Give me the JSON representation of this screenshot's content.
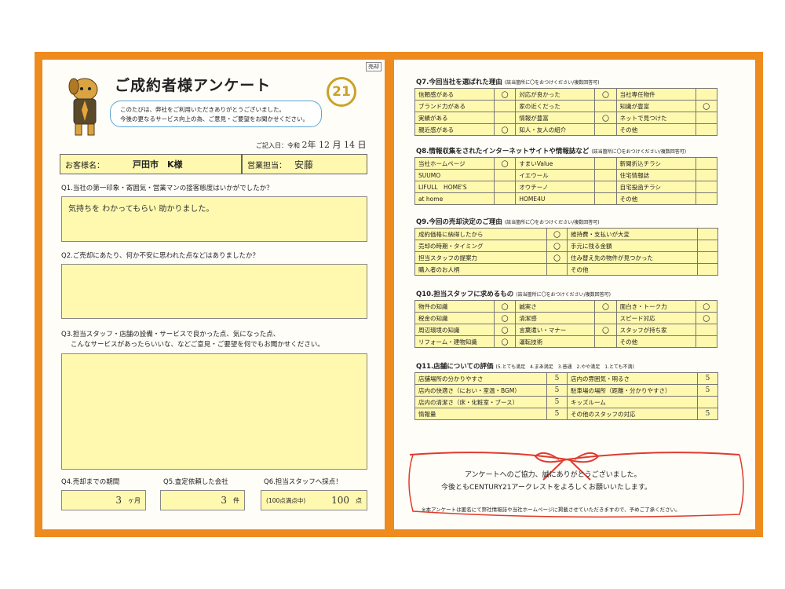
{
  "left": {
    "tag": "売却",
    "title": "ご成約者様アンケート",
    "logo": "21",
    "greeting": [
      "このたびは、弊社をご利用いただきありがとうございました。",
      "今後の更なるサービス向上の為、ご意見・ご要望をお聞かせください。"
    ],
    "date_label": "ご記入日：令和",
    "date_value": "2年 12 月 14 日",
    "customer_label": "お客様名：",
    "customer_value": "戸田市　K様",
    "staff_label": "営業担当：",
    "staff_value": "安藤 "
  },
  "q1": {
    "text": "Q1.当社の第一印象・寄囲気・営業マンの接客態度はいかがでしたか？",
    "answer": "気持ちを わかってもらい 助かりました。"
  },
  "q2": {
    "text": "Q2.ご売却にあたり、何か不安に思われた点などはありましたか？",
    "answer": ""
  },
  "q3": {
    "text": [
      "Q3.担当スタッフ・店舗の設備・サービスで良かった点、気になった点、",
      "こんなサービスがあったらいいな、などご意見・ご要望を何でもお聞かせください。"
    ],
    "answer": ""
  },
  "q4": {
    "text": "Q4.売却までの期間",
    "value": "3",
    "unit": "ヶ月"
  },
  "q5": {
    "text": "Q5.査定依頼した会社",
    "value": "3",
    "unit": "件"
  },
  "q6": {
    "text": "Q6.担当スタッフへ採点！",
    "pre": "(100点満点中)",
    "value": "100",
    "unit": "点"
  },
  "q7": {
    "title": "Q7.今回当社を選ばれた理由",
    "note": "(該当箇所に〇をおつけください/複数回答可)",
    "rows": [
      [
        "信頼感がある",
        "〇",
        "対応が良かった",
        "〇",
        "当社専任物件",
        ""
      ],
      [
        "ブランド力がある",
        "",
        "家の近くだった",
        "",
        "知識が豊富",
        "〇"
      ],
      [
        "実績がある",
        "",
        "情報が豊富",
        "〇",
        "ネットで見つけた",
        ""
      ],
      [
        "親近感がある",
        "〇",
        "知人・友人の紹介",
        "",
        "その他",
        ""
      ]
    ]
  },
  "q8": {
    "title": "Q8.情報収集をされたインターネットサイトや情報誌など",
    "note": "(該当箇所に〇をおつけください/複数回答可)",
    "rows": [
      [
        "当社ホームページ",
        "〇",
        "すまいValue",
        "",
        "新聞折込チラシ",
        ""
      ],
      [
        "SUUMO",
        "",
        "イエウール",
        "",
        "住宅情報誌",
        ""
      ],
      [
        "LIFULL　HOME'S",
        "",
        "オウチーノ",
        "",
        "自宅投函チラシ",
        ""
      ],
      [
        "at home",
        "",
        "HOME4U",
        "",
        "その他",
        ""
      ]
    ]
  },
  "q9": {
    "title": "Q9.今回の売却決定のご理由",
    "note": "(該当箇所に〇をおつけください/複数回答可)",
    "rows": [
      [
        "成約価格に納得したから",
        "〇",
        "維持費・支払いが大変",
        ""
      ],
      [
        "売却の時期・タイミング",
        "〇",
        "手元に残る金額",
        ""
      ],
      [
        "担当スタッフの提案力",
        "〇",
        "住み替え先の物件が見つかった",
        ""
      ],
      [
        "購入者のお人柄",
        "",
        "その他",
        ""
      ]
    ]
  },
  "q10": {
    "title": "Q10.担当スタッフに求めるもの",
    "note": "(該当箇所に〇をおつけください/複数回答可)",
    "rows": [
      [
        "物件の知識",
        "〇",
        "誠実さ",
        "〇",
        "面白き・トーク力",
        "〇"
      ],
      [
        "税金の知識",
        "〇",
        "清潔感",
        "",
        "スピード対応",
        "〇"
      ],
      [
        "周辺環境の知識",
        "〇",
        "言葉遣い・マナー",
        "〇",
        "スタッフが持ち家",
        ""
      ],
      [
        "リフォーム・建物知識",
        "〇",
        "運転技術",
        "",
        "その他",
        ""
      ]
    ]
  },
  "q11": {
    "title": "Q11.店舗についての評価",
    "scale": "(5.とても満足　4.まあ満足　3.普通　2.やや満足　1.とても不満)",
    "rows": [
      [
        "店舗場所の分かりやすさ",
        "5",
        "店内の雰囲気・明るさ",
        "5"
      ],
      [
        "店内の快適さ（におい・室温・BGM）",
        "5",
        "駐車場の場所（距離・分かりやすさ）",
        "5"
      ],
      [
        "店内の清潔さ（床・化粧室・ブース）",
        "5",
        "キッズルーム",
        ""
      ],
      [
        "情報量",
        "5",
        "その他のスタッフの対応",
        "5"
      ]
    ]
  },
  "thanks": {
    "line1": "アンケートへのご協力、誠にありがとうございました。",
    "line2": "今後ともCENTURY21アークレストをよろしくお願いいたします。",
    "note": "※本アンケートは匿名にて弊社情報誌や当社ホームページに掲載させていただきますので、予めご了承ください。"
  },
  "colors": {
    "frame": "#ee8b1f",
    "fill": "#fff9b0",
    "ribbon": "#e03a2e",
    "logo": "#c9a227"
  }
}
